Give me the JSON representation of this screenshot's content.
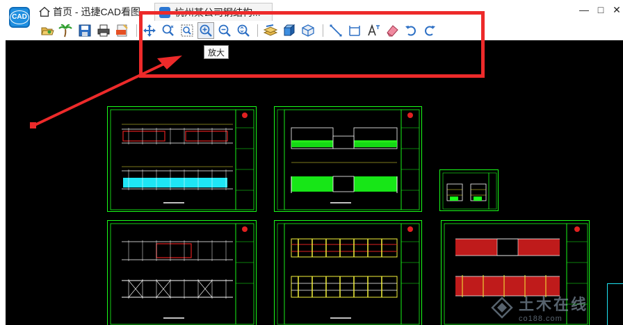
{
  "titlebar": {
    "logo_text": "CAD",
    "home_tab_label": "首页 - 迅捷CAD看图",
    "document_tab_label": "杭州某公司钢结构...",
    "window_controls": {
      "minimize": "—",
      "maximize": "□",
      "close": "✕"
    }
  },
  "toolbar": {
    "buttons": [
      {
        "name": "open-folder-icon"
      },
      {
        "name": "palm-tree-icon"
      },
      {
        "name": "save-icon"
      },
      {
        "name": "print-icon"
      },
      {
        "name": "pdf-export-icon"
      },
      {
        "name": "pan-icon"
      },
      {
        "name": "zoom-realtime-icon"
      },
      {
        "name": "zoom-window-icon"
      },
      {
        "name": "zoom-in-icon",
        "active": true
      },
      {
        "name": "zoom-out-icon"
      },
      {
        "name": "zoom-extents-icon"
      },
      {
        "name": "layers-icon"
      },
      {
        "name": "3d-box-icon"
      },
      {
        "name": "3d-view-icon"
      },
      {
        "name": "measure-line-icon"
      },
      {
        "name": "dimension-icon"
      },
      {
        "name": "text-icon"
      },
      {
        "name": "eraser-icon"
      },
      {
        "name": "undo-icon"
      },
      {
        "name": "redo-icon"
      }
    ]
  },
  "tooltip": {
    "text": "放大"
  },
  "watermark": {
    "main": "土木在线",
    "sub": "co188.com"
  },
  "colors": {
    "annotation_red": "#ed2a2a",
    "sheet_green": "#19ff19",
    "drawing_yellow": "#f5f23a",
    "drawing_red": "#e02020",
    "drawing_cyan": "#1ee6f5",
    "canvas_bg": "#000000"
  }
}
